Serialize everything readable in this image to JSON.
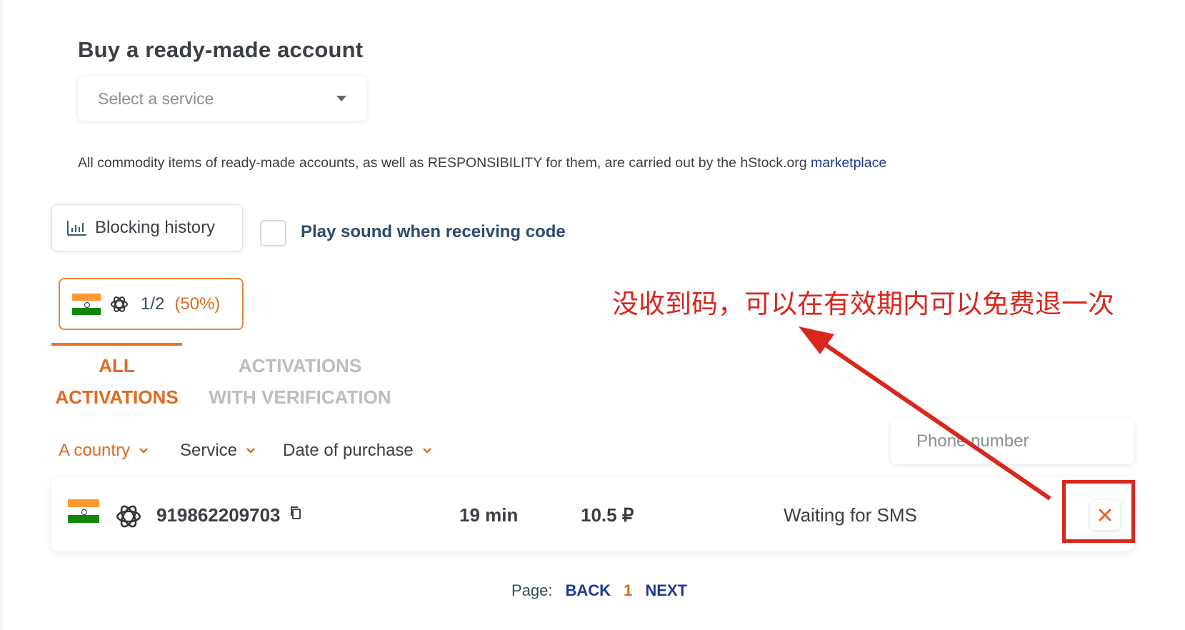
{
  "page": {
    "title": "Buy a ready-made account",
    "service_select": {
      "placeholder": "Select a service"
    },
    "notice": {
      "text": "All commodity items of ready-made accounts, as well as RESPONSIBILITY for them, are carried out by the hStock.org ",
      "link": "marketplace"
    },
    "blocking_history": {
      "label": "Blocking history",
      "icon": "bar-chart-icon"
    },
    "play_sound": {
      "label": "Play sound when receiving code",
      "checked": false
    },
    "country_chip": {
      "flag": "india-flag",
      "service_icon": "openai-icon",
      "ratio": "1/2",
      "percent": "(50%)"
    },
    "tabs": [
      {
        "label_line1": "ALL",
        "label_line2": "ACTIVATIONS",
        "active": true
      },
      {
        "label_line1": "ACTIVATIONS",
        "label_line2": "WITH VERIFICATION",
        "active": false
      }
    ],
    "filters": [
      {
        "label": "A country",
        "active": true
      },
      {
        "label": "Service",
        "active": false
      },
      {
        "label": "Date of purchase",
        "active": false
      }
    ],
    "phone_search": {
      "placeholder": "Phone number"
    },
    "activations": [
      {
        "flag": "india-flag",
        "service_icon": "openai-icon",
        "number": "919862209703",
        "time": "19 min",
        "price": "10.5 ₽",
        "status": "Waiting for SMS"
      }
    ],
    "pagination": {
      "label": "Page:",
      "back": "BACK",
      "current": "1",
      "next": "NEXT"
    }
  },
  "annotation": {
    "text": "没收到码，可以在有效期内可以免费退一次",
    "color": "#d9271e"
  },
  "colors": {
    "accent": "#e06a1f",
    "link": "#1f3a8f",
    "annotation": "#d9271e"
  }
}
